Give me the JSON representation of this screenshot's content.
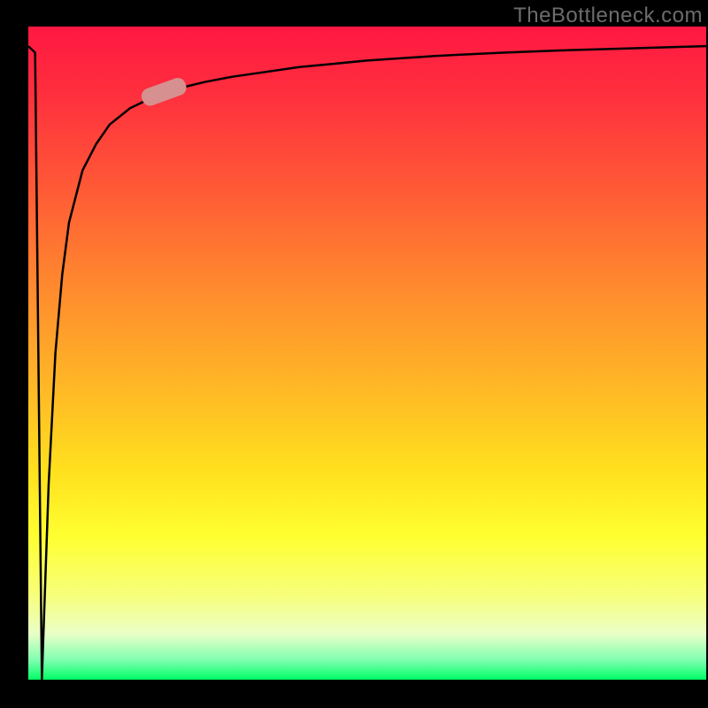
{
  "attribution": "TheBottleneck.com",
  "chart_data": {
    "type": "line",
    "title": "",
    "xlabel": "",
    "ylabel": "",
    "xlim": [
      0,
      100
    ],
    "ylim": [
      0,
      100
    ],
    "background_gradient": {
      "orientation": "vertical",
      "stops": [
        {
          "pct": 0,
          "color": "#ff1842",
          "meaning": "high"
        },
        {
          "pct": 50,
          "color": "#ffb020",
          "meaning": "mid-high"
        },
        {
          "pct": 80,
          "color": "#ffff30",
          "meaning": "mid"
        },
        {
          "pct": 100,
          "color": "#00ff66",
          "meaning": "low"
        }
      ]
    },
    "series": [
      {
        "name": "curve",
        "x": [
          0,
          1,
          2,
          3,
          4,
          5,
          6,
          8,
          10,
          12,
          15,
          18,
          22,
          26,
          30,
          40,
          50,
          60,
          70,
          80,
          90,
          100
        ],
        "y": [
          97,
          96,
          0,
          30,
          50,
          62,
          70,
          78,
          82,
          85,
          87.5,
          89,
          90.5,
          91.5,
          92.3,
          93.8,
          94.8,
          95.5,
          96.0,
          96.4,
          96.7,
          97.0
        ]
      }
    ],
    "marker": {
      "series": "curve",
      "x": 20,
      "y": 90,
      "color": "#d6908f"
    }
  }
}
